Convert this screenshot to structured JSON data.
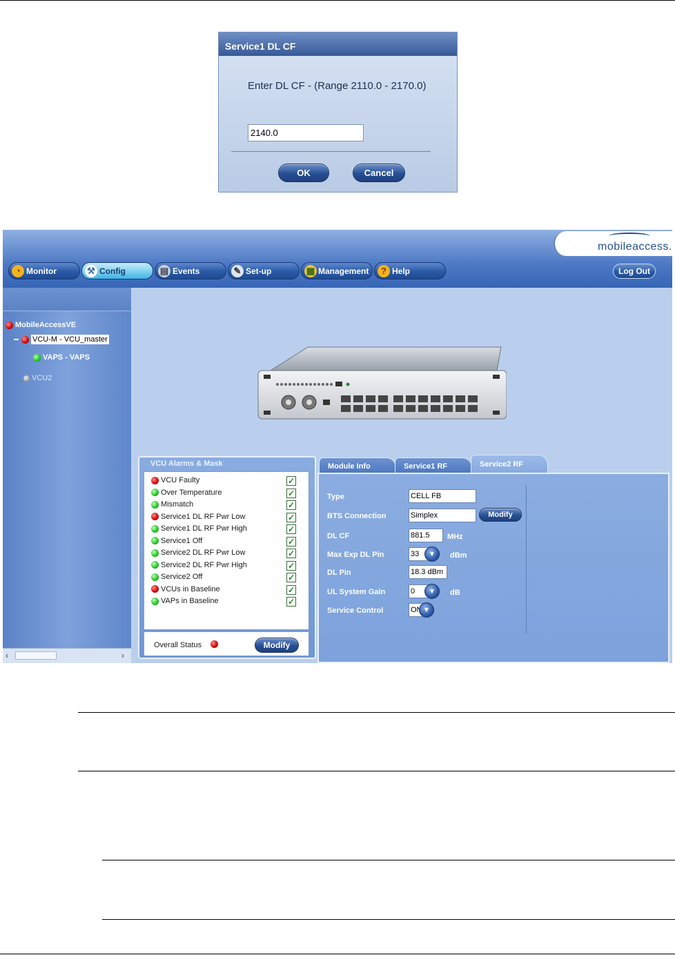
{
  "dialog": {
    "title": "Service1 DL CF",
    "prompt": "Enter DL CF - (Range 2110.0 - 2170.0)",
    "input_value": "2140.0",
    "ok_label": "OK",
    "cancel_label": "Cancel"
  },
  "app": {
    "brand": "mobileaccess.",
    "tabs": [
      {
        "label": "Monitor",
        "icon": "monitor-icon"
      },
      {
        "label": "Config",
        "icon": "wrench-icon"
      },
      {
        "label": "Events",
        "icon": "events-icon"
      },
      {
        "label": "Set-up",
        "icon": "setup-icon"
      },
      {
        "label": "Management",
        "icon": "management-icon"
      },
      {
        "label": "Help",
        "icon": "help-icon"
      }
    ],
    "active_tab": "Config",
    "logout_label": "Log Out",
    "tree": {
      "root": "MobileAccessVE",
      "vcu_master": "VCU-M - VCU_master",
      "vaps": "VAPS - VAPS",
      "vcu2": "VCU2"
    },
    "alarms": {
      "title": "VCU Alarms & Mask",
      "items": [
        {
          "label": "VCU Faulty",
          "status": "red",
          "checked": true
        },
        {
          "label": "Over Temperature",
          "status": "green",
          "checked": true
        },
        {
          "label": "Mismatch",
          "status": "green",
          "checked": true
        },
        {
          "label": "Service1 DL RF Pwr Low",
          "status": "red",
          "checked": true
        },
        {
          "label": "Service1 DL RF Pwr High",
          "status": "green",
          "checked": true
        },
        {
          "label": "Service1 Off",
          "status": "green",
          "checked": true
        },
        {
          "label": "Service2 DL RF Pwr Low",
          "status": "green",
          "checked": true
        },
        {
          "label": "Service2 DL RF Pwr High",
          "status": "green",
          "checked": true
        },
        {
          "label": "Service2 Off",
          "status": "green",
          "checked": true
        },
        {
          "label": "VCUs in Baseline",
          "status": "red",
          "checked": true
        },
        {
          "label": "VAPs in Baseline",
          "status": "green",
          "checked": true
        }
      ],
      "overall_label": "Overall Status",
      "overall_status": "red",
      "modify_label": "Modify"
    },
    "rf": {
      "tabs": [
        "Module Info",
        "Service1 RF",
        "Service2 RF"
      ],
      "active_tab": "Service2 RF",
      "fields": {
        "type_label": "Type",
        "type_value": "CELL FB",
        "bts_label": "BTS Connection",
        "bts_value": "Simplex",
        "bts_modify": "Modify",
        "dlcf_label": "DL CF",
        "dlcf_value": "881.5",
        "dlcf_unit": "MHz",
        "maxexp_label": "Max Exp DL Pin",
        "maxexp_value": "33",
        "maxexp_unit": "dBm",
        "dlpin_label": "DL Pin",
        "dlpin_value": "18.3 dBm",
        "ulgain_label": "UL System Gain",
        "ulgain_value": "0",
        "ulgain_unit": "dB",
        "svc_label": "Service Control",
        "svc_value": "ON"
      }
    }
  },
  "colors": {
    "header_blue": "#3766b6",
    "panel_blue": "#8aace0",
    "active_tab": "#7ccff0",
    "status_red": "#d20000",
    "status_green": "#1fc41f"
  }
}
